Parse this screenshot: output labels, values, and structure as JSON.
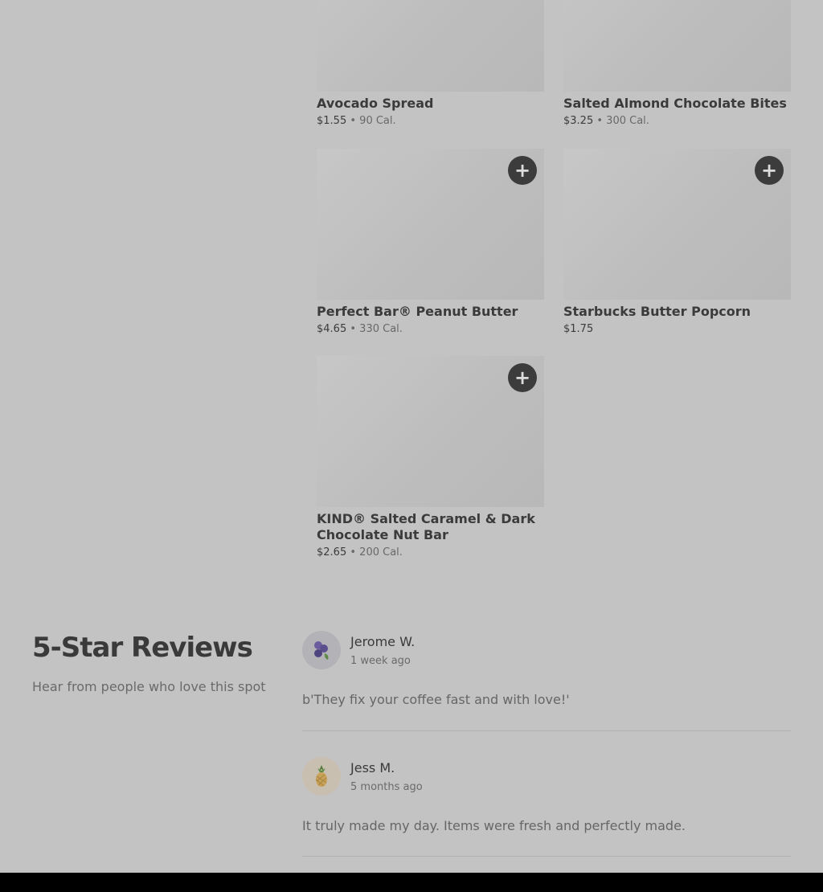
{
  "menu": {
    "items": [
      {
        "name": "Avocado Spread",
        "price": "$1.55",
        "separator": "•",
        "calories": "90 Cal."
      },
      {
        "name": "Salted Almond Chocolate Bites",
        "price": "$3.25",
        "separator": "•",
        "calories": "300 Cal."
      },
      {
        "name": "Perfect Bar® Peanut Butter",
        "price": "$4.65",
        "separator": "•",
        "calories": "330 Cal."
      },
      {
        "name": "Starbucks Butter Popcorn",
        "price": "$1.75"
      },
      {
        "name": "KIND® Salted Caramel & Dark Chocolate Nut Bar",
        "price": "$2.65",
        "separator": "•",
        "calories": "200 Cal."
      }
    ],
    "add_symbol": "+"
  },
  "reviews": {
    "title": "5-Star Reviews",
    "subtitle": "Hear from people who love this spot",
    "list": [
      {
        "author": "Jerome W.",
        "date": "1 week ago",
        "text": "b'They fix your coffee fast and with love!'",
        "avatar_icon": "blueberries-icon"
      },
      {
        "author": "Jess M.",
        "date": "5 months ago",
        "text": "It truly made my day. Items were fresh and perfectly made.",
        "avatar_icon": "pineapple-icon"
      }
    ]
  },
  "colors": {
    "overlay_background": "#c3c3c3",
    "add_button": "#3c3c3c",
    "footer": "#000000"
  }
}
